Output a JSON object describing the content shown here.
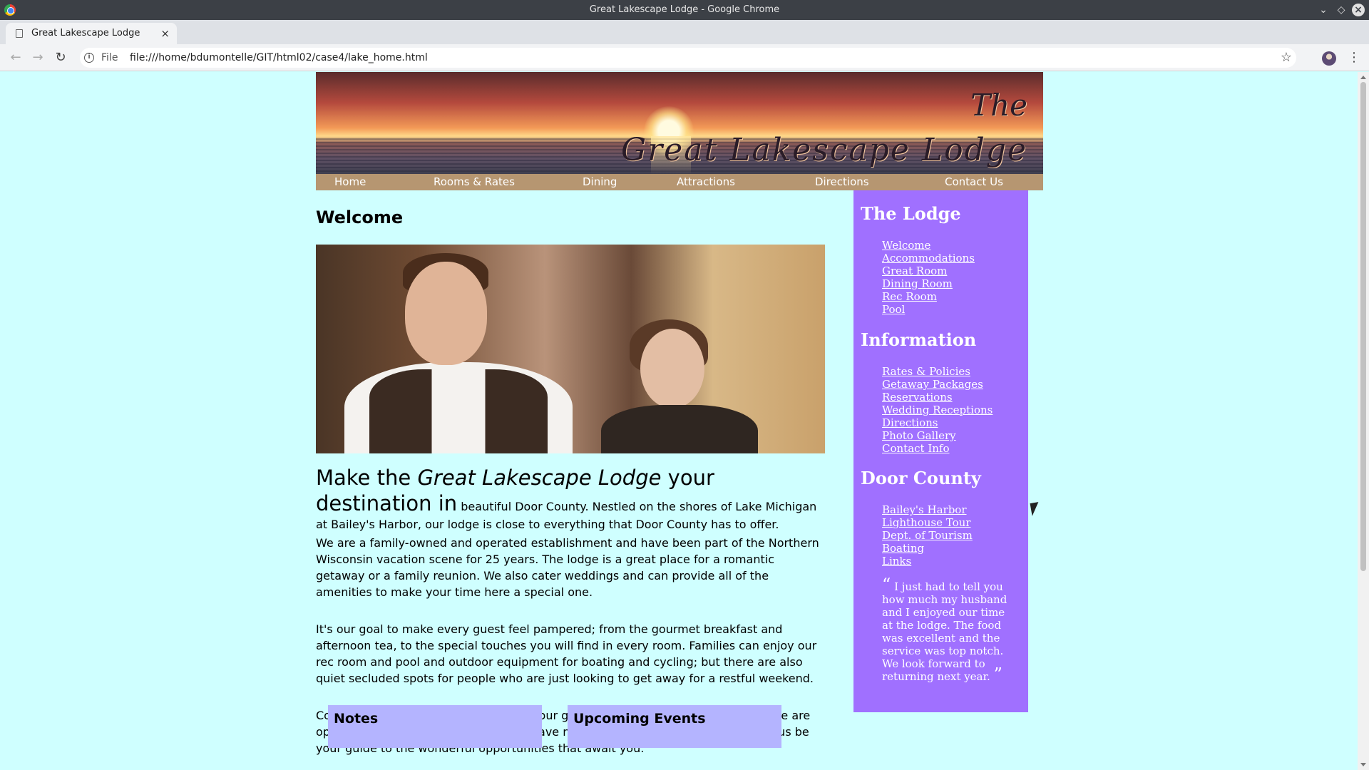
{
  "window": {
    "title": "Great Lakescape Lodge - Google Chrome"
  },
  "tab": {
    "title": "Great Lakescape Lodge",
    "close": "×",
    "new": "+"
  },
  "toolbar": {
    "back": "←",
    "forward": "→",
    "reload": "↻",
    "protocol": "File",
    "url": "file:///home/bdumontelle/GIT/html02/case4/lake_home.html",
    "star": "☆",
    "menu": "⋮"
  },
  "banner": {
    "logo_the": "The",
    "logo_name": "Great Lakescape Lodge"
  },
  "topnav": [
    "Home",
    "Rooms & Rates",
    "Dining",
    "Attractions",
    "Directions",
    "Contact Us"
  ],
  "main": {
    "heading": "Welcome",
    "lead_prefix": "Make the ",
    "lead_italic": "Great Lakescape Lodge",
    "lead_suffix": " your destination in",
    "lead_rest": "beautiful Door County. Nestled on the shores of Lake Michigan at Bailey's Harbor, our lodge is close to everything that Door County has to offer.",
    "para2": "We are a family-owned and operated establishment and have been part of the Northern Wisconsin vacation scene for 25 years. The lodge is a great place for a romantic getaway or a family reunion. We also cater weddings and can provide all of the amenities to make your time here a special one.",
    "para3": "It's our goal to make every guest feel pampered; from the gourmet breakfast and afternoon tea, to the special touches you will find in every room. Families can enjoy our rec room and pool and outdoor equipment for boating and cycling; but there are also quiet secluded spots for people who are just looking to get away for a restful weekend.",
    "para4": "Come and see for yourself what keeps our guests coming back year after year. We are open April 1st to October 31st. If you have never visited Door County before, let us be your guide to the wonderful opportunities that await you.",
    "notes_title": "Notes",
    "events_title": "Upcoming Events"
  },
  "aside": {
    "lodge_title": "The Lodge",
    "lodge_links": [
      "Welcome",
      "Accommodations",
      "Great Room",
      "Dining Room",
      "Rec Room",
      "Pool"
    ],
    "info_title": "Information",
    "info_links": [
      "Rates & Policies",
      "Getaway Packages",
      "Reservations",
      "Wedding Receptions",
      "Directions",
      "Photo Gallery",
      "Contact Info"
    ],
    "door_title": "Door County",
    "door_links": [
      "Bailey's Harbor",
      "Lighthouse Tour",
      "Dept. of Tourism",
      "Boating",
      "Links"
    ],
    "quote_open": "“",
    "quote": "I just had to tell you how much my husband and I enjoyed our time at the lodge. The food was excellent and the service was top notch. We look forward to returning next year.",
    "quote_close": "”"
  },
  "colors": {
    "page_bg": "#cfffff",
    "nav_bg": "#b69671",
    "aside_bg": "#a070ff",
    "box_bg": "#b4b4ff"
  }
}
